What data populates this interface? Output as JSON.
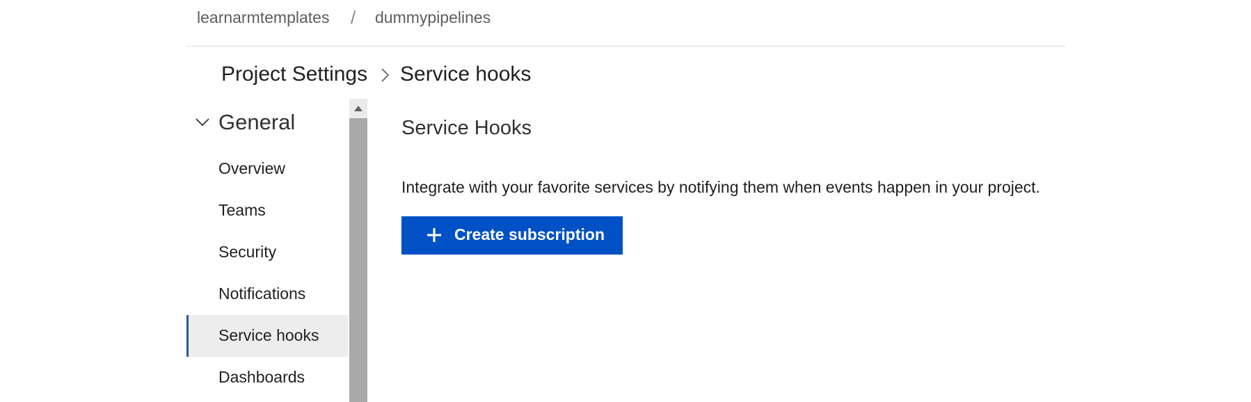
{
  "breadcrumb": {
    "organization": "learnarmtemplates",
    "separator": "/",
    "project": "dummypipelines"
  },
  "header": {
    "section": "Project Settings",
    "page": "Service hooks"
  },
  "sidebar": {
    "group": {
      "label": "General",
      "expanded": true,
      "icon": "chevron-down-icon"
    },
    "items": [
      {
        "label": "Overview",
        "selected": false
      },
      {
        "label": "Teams",
        "selected": false
      },
      {
        "label": "Security",
        "selected": false
      },
      {
        "label": "Notifications",
        "selected": false
      },
      {
        "label": "Service hooks",
        "selected": true
      },
      {
        "label": "Dashboards",
        "selected": false
      }
    ]
  },
  "main": {
    "heading": "Service Hooks",
    "description": "Integrate with your favorite services by notifying them when events happen in your project.",
    "create_button": {
      "label": "Create subscription",
      "icon": "plus-icon"
    }
  },
  "colors": {
    "accent": "#0051c6",
    "selected_bg": "#ededed",
    "selected_bar": "#2b5797",
    "scrollbar_thumb": "#a9a9a9"
  }
}
